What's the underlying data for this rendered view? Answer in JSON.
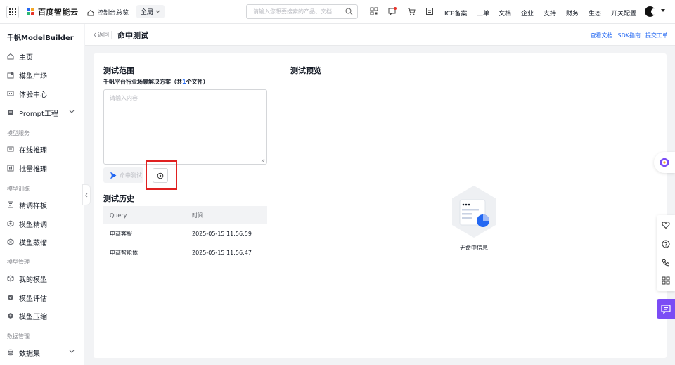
{
  "topbar": {
    "brand": "百度智能云",
    "console": "控制台总览",
    "scope": "全局",
    "search_placeholder": "请输入您想要搜索的产品、文档",
    "nav": [
      "ICP备案",
      "工单",
      "文档",
      "企业",
      "支持",
      "财务",
      "生态",
      "开关配置"
    ]
  },
  "sidebar": {
    "title": "千帆ModelBuilder",
    "items": [
      {
        "label": "主页"
      },
      {
        "label": "模型广场"
      },
      {
        "label": "体验中心"
      },
      {
        "label": "Prompt工程"
      }
    ],
    "groups": [
      {
        "label": "模型服务",
        "items": [
          "在线推理",
          "批量推理"
        ]
      },
      {
        "label": "模型训练",
        "items": [
          "精调样板",
          "模型精调",
          "模型蒸馏"
        ]
      },
      {
        "label": "模型管理",
        "items": [
          "我的模型",
          "模型评估",
          "模型压缩"
        ]
      },
      {
        "label": "数据管理",
        "items": [
          "数据集"
        ]
      }
    ]
  },
  "header": {
    "back": "返回",
    "title": "命中测试",
    "links": [
      "查看文档",
      "SDK指南",
      "提交工单"
    ]
  },
  "test_scope": {
    "title": "测试范围",
    "files_prefix": "千帆平台行业场景解决方案（共",
    "files_count": "1",
    "files_suffix": "个文件）",
    "placeholder": "请输入内容",
    "test_button": "命中测试"
  },
  "history": {
    "title": "测试历史",
    "columns": [
      "Query",
      "时间"
    ],
    "rows": [
      {
        "query": "电商客服",
        "time": "2025-05-15 11:56:59"
      },
      {
        "query": "电商智能体",
        "time": "2025-05-15 11:56:47"
      }
    ]
  },
  "preview": {
    "title": "测试预览",
    "empty_text": "无命中信息"
  },
  "colors": {
    "accent": "#2468f2",
    "highlight": "#e02020",
    "chat": "#7b4cf5"
  }
}
